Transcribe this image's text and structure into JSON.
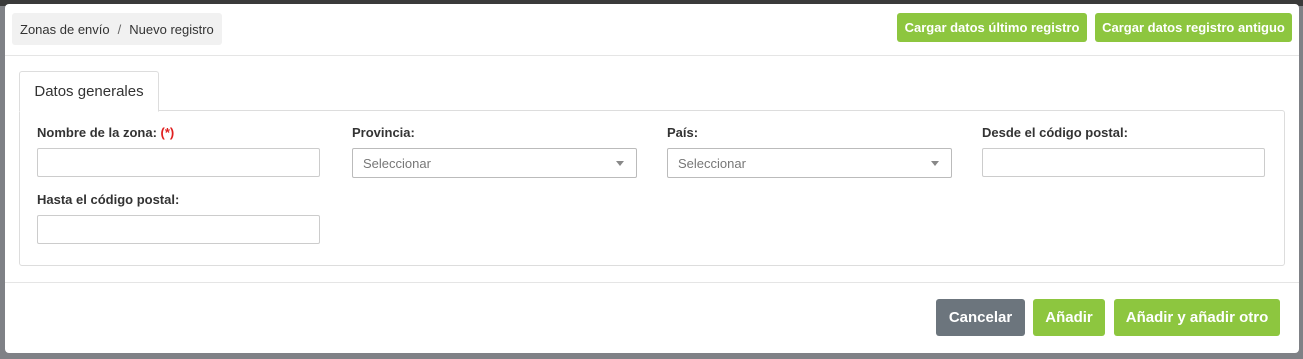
{
  "breadcrumb": {
    "parent": "Zonas de envío",
    "separator": "/",
    "current": "Nuevo registro"
  },
  "header_actions": {
    "load_last": "Cargar datos último registro",
    "load_old": "Cargar datos registro antiguo"
  },
  "tabs": [
    {
      "label": "Datos generales",
      "active": true
    }
  ],
  "form": {
    "zone_name": {
      "label": "Nombre de la zona:",
      "required_mark": "(*)",
      "value": ""
    },
    "province": {
      "label": "Provincia:",
      "selected": "Seleccionar"
    },
    "country": {
      "label": "País:",
      "selected": "Seleccionar"
    },
    "postal_from": {
      "label": "Desde el código postal:",
      "value": ""
    },
    "postal_to": {
      "label": "Hasta el código postal:",
      "value": ""
    }
  },
  "footer": {
    "cancel": "Cancelar",
    "add": "Añadir",
    "add_another": "Añadir y añadir otro"
  },
  "colors": {
    "accent_green": "#8dc63f",
    "cancel_gray": "#6c757d",
    "required_red": "#e02020"
  }
}
